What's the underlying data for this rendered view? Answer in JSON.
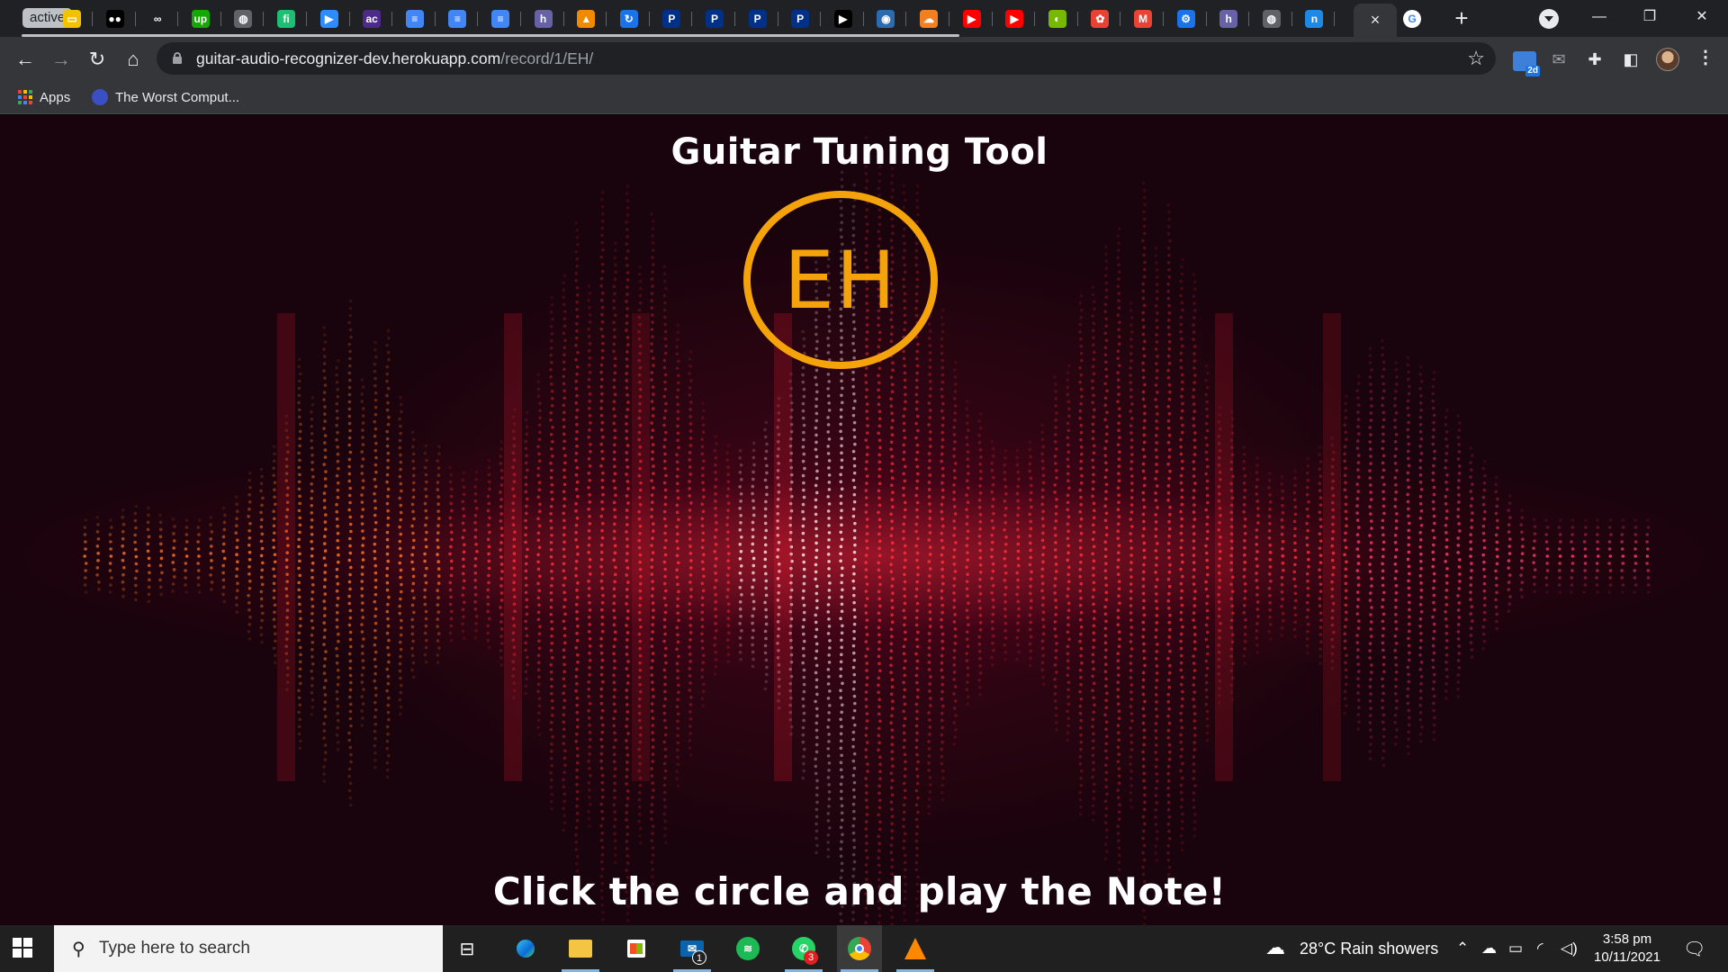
{
  "browser": {
    "tab_group_label": "active",
    "tab_favicons": [
      {
        "icon": "idea-icon",
        "color": "#f2c200",
        "glyph": "▭"
      },
      {
        "icon": "medium-icon",
        "color": "#000000",
        "glyph": "●●"
      },
      {
        "icon": "coursera-icon",
        "color": "#202124",
        "glyph": "∞"
      },
      {
        "icon": "upwork-icon",
        "color": "#14a800",
        "glyph": "up"
      },
      {
        "icon": "globe-icon",
        "color": "#5f6368",
        "glyph": "◍"
      },
      {
        "icon": "fiverr-icon",
        "color": "#1dbf73",
        "glyph": "fi"
      },
      {
        "icon": "zoom-icon",
        "color": "#2d8cff",
        "glyph": "▶"
      },
      {
        "icon": "ac-icon",
        "color": "#4b2a8a",
        "glyph": "ac"
      },
      {
        "icon": "docs-icon",
        "color": "#4285f4",
        "glyph": "≡"
      },
      {
        "icon": "docs-icon",
        "color": "#4285f4",
        "glyph": "≡"
      },
      {
        "icon": "docs-icon",
        "color": "#4285f4",
        "glyph": "≡"
      },
      {
        "icon": "heroku-icon",
        "color": "#6762a6",
        "glyph": "h"
      },
      {
        "icon": "sketchup-icon",
        "color": "#f08a00",
        "glyph": "▲"
      },
      {
        "icon": "refresh-icon",
        "color": "#1a73e8",
        "glyph": "↻"
      },
      {
        "icon": "paypal-icon",
        "color": "#003087",
        "glyph": "P"
      },
      {
        "icon": "paypal-icon",
        "color": "#003087",
        "glyph": "P"
      },
      {
        "icon": "paypal-icon",
        "color": "#003087",
        "glyph": "P"
      },
      {
        "icon": "paypal-icon",
        "color": "#003087",
        "glyph": "P"
      },
      {
        "icon": "play-icon",
        "color": "#000000",
        "glyph": "▶"
      },
      {
        "icon": "earth-icon",
        "color": "#2b6cb0",
        "glyph": "◉"
      },
      {
        "icon": "cloud-icon",
        "color": "#f38020",
        "glyph": "☁"
      },
      {
        "icon": "youtube-icon",
        "color": "#ff0000",
        "glyph": "▶"
      },
      {
        "icon": "youtube-icon",
        "color": "#ff0000",
        "glyph": "▶"
      },
      {
        "icon": "nvidia-icon",
        "color": "#76b900",
        "glyph": "◐"
      },
      {
        "icon": "pinwheel-icon",
        "color": "#e94235",
        "glyph": "✿"
      },
      {
        "icon": "gmail-icon",
        "color": "#ea4335",
        "glyph": "M"
      },
      {
        "icon": "gear-icon",
        "color": "#1a73e8",
        "glyph": "⚙"
      },
      {
        "icon": "heroku-icon",
        "color": "#6762a6",
        "glyph": "h"
      },
      {
        "icon": "globe-icon",
        "color": "#5f6368",
        "glyph": "◍"
      },
      {
        "icon": "n-icon",
        "color": "#1e88e5",
        "glyph": "n"
      }
    ],
    "active_tab_close": "×",
    "after_tab_icon": {
      "icon": "google-icon",
      "color": "#ffffff",
      "glyph": "G"
    },
    "new_tab": "+",
    "window_controls": {
      "minimize": "—",
      "restore": "❐",
      "close": "✕"
    },
    "url_host": "guitar-audio-recognizer-dev.herokuapp.com",
    "url_path": "/record/1/EH/",
    "ext_badge": "2d",
    "bookmarks": [
      {
        "label": "Apps"
      },
      {
        "label": "The Worst Comput..."
      }
    ],
    "colors": {
      "chrome_dark": "#202124",
      "toolbar": "#35363a"
    }
  },
  "page": {
    "title": "Guitar Tuning Tool",
    "note_label": "EH",
    "instruction": "Click the circle and play the Note!",
    "colors": {
      "accent": "#f5a30b",
      "text": "#ffffff",
      "background": "#1a0610"
    }
  },
  "taskbar": {
    "search_placeholder": "Type here to search",
    "mail_badge": "1",
    "whatsapp_badge": "3",
    "weather": "28°C  Rain showers",
    "time": "3:58 pm",
    "date": "10/11/2021"
  }
}
